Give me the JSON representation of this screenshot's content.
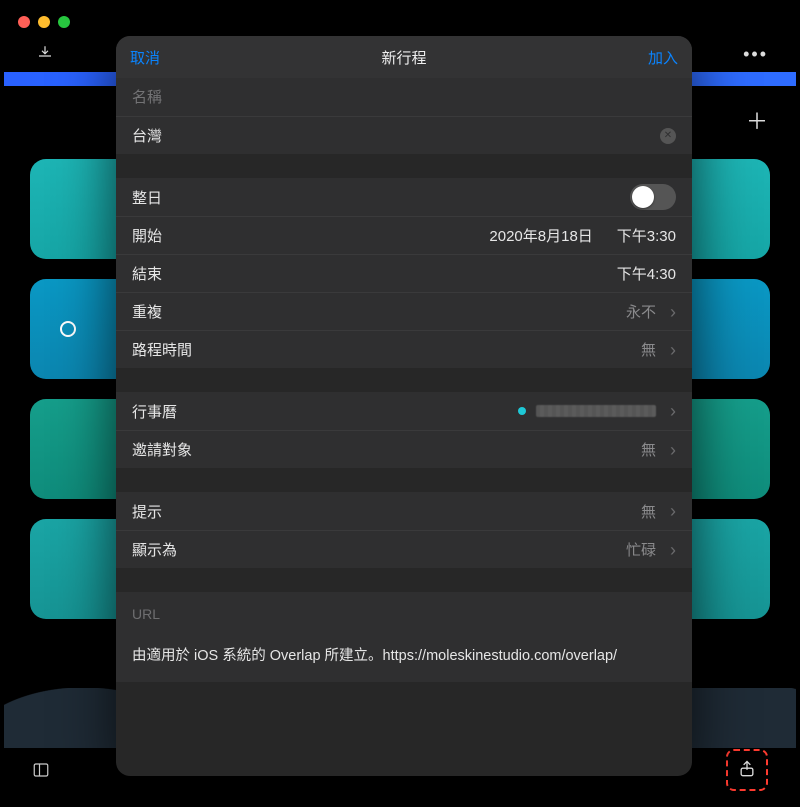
{
  "window": {
    "title": ""
  },
  "sheet": {
    "cancel_label": "取消",
    "title": "新行程",
    "add_label": "加入",
    "name_placeholder": "名稱",
    "location_value": "台灣",
    "allday_label": "整日",
    "start_label": "開始",
    "start_date": "2020年8月18日",
    "start_time": "下午3:30",
    "end_label": "結束",
    "end_time": "下午4:30",
    "repeat_label": "重複",
    "repeat_value": "永不",
    "travel_label": "路程時間",
    "travel_value": "無",
    "calendar_label": "行事曆",
    "invite_label": "邀請對象",
    "invite_value": "無",
    "alert_label": "提示",
    "alert_value": "無",
    "showas_label": "顯示為",
    "showas_value": "忙碌",
    "url_label": "URL",
    "notes_text": "由適用於 iOS 系統的 Overlap 所建立。https://moleskinestudio.com/overlap/"
  }
}
